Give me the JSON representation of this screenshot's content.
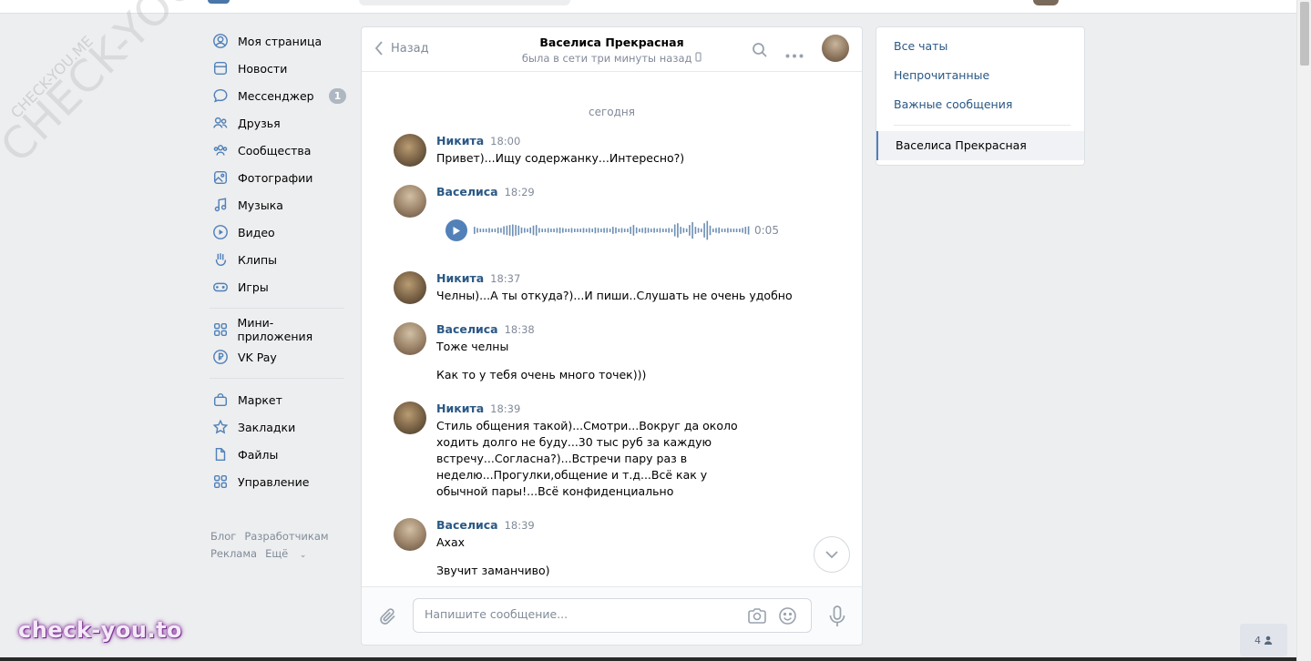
{
  "watermark": {
    "big": "CHECK-YOU.ME",
    "small": "CHECK-YOU.ME",
    "brand": "check-you.to"
  },
  "nav": {
    "items": [
      {
        "label": "Моя страница",
        "icon": "user-circle-icon"
      },
      {
        "label": "Новости",
        "icon": "news-icon"
      },
      {
        "label": "Мессенджер",
        "icon": "message-icon",
        "badge": "1"
      },
      {
        "label": "Друзья",
        "icon": "friends-icon"
      },
      {
        "label": "Сообщества",
        "icon": "communities-icon"
      },
      {
        "label": "Фотографии",
        "icon": "photo-icon"
      },
      {
        "label": "Музыка",
        "icon": "music-icon"
      },
      {
        "label": "Видео",
        "icon": "video-icon"
      },
      {
        "label": "Клипы",
        "icon": "clips-icon"
      },
      {
        "label": "Игры",
        "icon": "gamepad-icon"
      }
    ],
    "items2": [
      {
        "label": "Мини-приложения",
        "icon": "apps-icon"
      },
      {
        "label": "VK Pay",
        "icon": "vkpay-icon"
      }
    ],
    "items3": [
      {
        "label": "Маркет",
        "icon": "market-icon"
      },
      {
        "label": "Закладки",
        "icon": "star-icon"
      },
      {
        "label": "Файлы",
        "icon": "file-icon"
      },
      {
        "label": "Управление",
        "icon": "apps-icon"
      }
    ],
    "footer": {
      "blog": "Блог",
      "developers": "Разработчикам",
      "ads": "Реклама",
      "more": "Ещё"
    }
  },
  "chat": {
    "back_label": "Назад",
    "peer_name": "Васелиса Прекрасная",
    "peer_status": "была в сети три минуты назад",
    "day_label": "сегодня",
    "messages": [
      {
        "author": "Никита",
        "time": "18:00",
        "lines": [
          "Привет)...Ищу содержанку...Интересно?)"
        ]
      },
      {
        "author": "Васелиса",
        "time": "18:29",
        "voice_duration": "0:05"
      },
      {
        "author": "Никита",
        "time": "18:37",
        "lines": [
          "Челны)...А ты откуда?)...И пиши..Слушать не очень удобно"
        ]
      },
      {
        "author": "Васелиса",
        "time": "18:38",
        "lines": [
          "Тоже челны",
          "Как то у тебя очень много точек)))"
        ]
      },
      {
        "author": "Никита",
        "time": "18:39",
        "lines": [
          "Стиль общения такой)...Смотри...Вокруг да около ходить долго не буду...30 тыс руб за каждую встречу...Согласна?)...Встречи пару раз в неделю...Прогулки,общение и т.д...Всё как у обычной пары!...Всё конфиденциально"
        ]
      },
      {
        "author": "Васелиса",
        "time": "18:39",
        "lines": [
          "Ахах",
          "Звучит заманчиво)"
        ]
      }
    ],
    "composer_placeholder": "Напишите сообщение..."
  },
  "right_panel": {
    "all_chats": "Все чаты",
    "unread": "Непрочитанные",
    "important": "Важные сообщения",
    "active_chat": "Васелиса Прекрасная"
  },
  "online_count": "4",
  "colors": {
    "link": "#2a5885",
    "accent": "#5181b8",
    "background": "#edeef0",
    "muted": "#828a99"
  }
}
